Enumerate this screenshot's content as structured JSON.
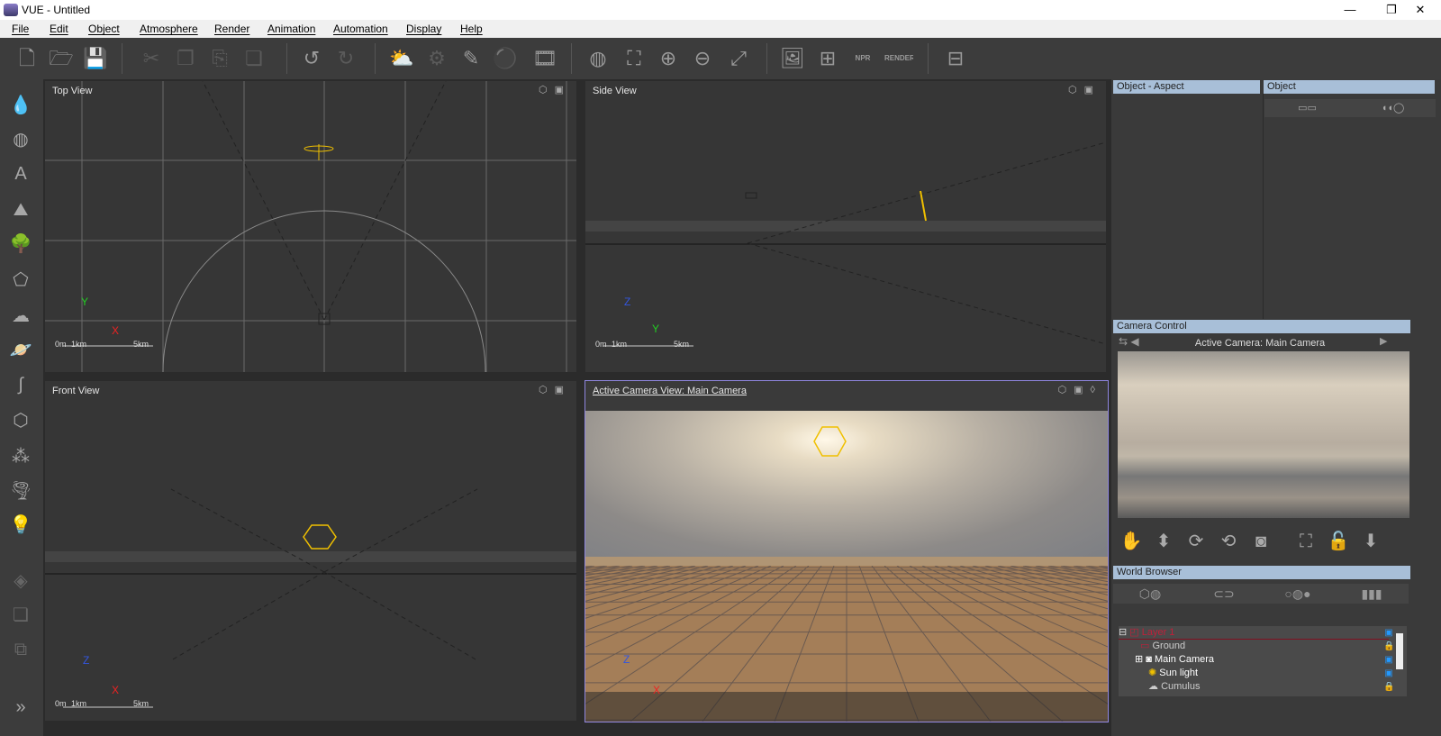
{
  "window": {
    "title": "VUE - Untitled",
    "controls": [
      "—",
      "❐",
      "✕"
    ]
  },
  "menu": [
    "File",
    "Edit",
    "Object",
    "Atmosphere",
    "Render",
    "Animation",
    "Automation",
    "Display",
    "Help"
  ],
  "toolbar": [
    {
      "icon": "new-file-icon",
      "glyph": "🗋"
    },
    {
      "icon": "open-folder-icon",
      "glyph": "🗁"
    },
    {
      "icon": "save-icon",
      "glyph": "💾"
    },
    {
      "icon": "cut-icon",
      "glyph": "✂"
    },
    {
      "icon": "copy-icon",
      "glyph": "❐"
    },
    {
      "icon": "paste-icon",
      "glyph": "⎘"
    },
    {
      "icon": "duplicate-icon",
      "glyph": "❏"
    },
    {
      "icon": "undo-icon",
      "glyph": "↺"
    },
    {
      "icon": "redo-icon",
      "glyph": "↻"
    },
    {
      "icon": "atmosphere-icon",
      "glyph": "⛅"
    },
    {
      "icon": "function-icon",
      "glyph": "⚙"
    },
    {
      "icon": "material-brush-icon",
      "glyph": "✎"
    },
    {
      "icon": "materials-icon",
      "glyph": "⚫"
    },
    {
      "icon": "film-icon",
      "glyph": "🎞"
    },
    {
      "icon": "globe-icon",
      "glyph": "◍"
    },
    {
      "icon": "frame-all-icon",
      "glyph": "⛶"
    },
    {
      "icon": "zoom-in-icon",
      "glyph": "⊕"
    },
    {
      "icon": "zoom-out-icon",
      "glyph": "⊖"
    },
    {
      "icon": "maximize-icon",
      "glyph": "⤢"
    },
    {
      "icon": "render-gallery-icon",
      "glyph": "🖼"
    },
    {
      "icon": "render-area-icon",
      "glyph": "⊞"
    },
    {
      "icon": "npr-render-icon",
      "glyph": "NPR"
    },
    {
      "icon": "render-icon",
      "glyph": "RENDER"
    },
    {
      "icon": "layout-icon",
      "glyph": "⊟"
    }
  ],
  "lefttools": [
    {
      "icon": "water-icon",
      "glyph": "💧"
    },
    {
      "icon": "sphere-icon",
      "glyph": "◍"
    },
    {
      "icon": "text-icon",
      "glyph": "A"
    },
    {
      "icon": "terrain-icon",
      "glyph": "⛰"
    },
    {
      "icon": "plant-icon",
      "glyph": "🌳"
    },
    {
      "icon": "rock-icon",
      "glyph": "⬠"
    },
    {
      "icon": "cloud-icon",
      "glyph": "☁"
    },
    {
      "icon": "planet-icon",
      "glyph": "🪐"
    },
    {
      "icon": "path-icon",
      "glyph": "∫"
    },
    {
      "icon": "cube-icon",
      "glyph": "⬡"
    },
    {
      "icon": "ecosystem-icon",
      "glyph": "⁂"
    },
    {
      "icon": "wind-icon",
      "glyph": "🌪"
    },
    {
      "icon": "light-icon",
      "glyph": "💡"
    },
    {
      "icon": "boolean-icon",
      "glyph": "◈"
    },
    {
      "icon": "group-icon",
      "glyph": "❏"
    },
    {
      "icon": "metablob-icon",
      "glyph": "⧉"
    },
    {
      "icon": "expand-icon",
      "glyph": "»"
    }
  ],
  "viewports": {
    "top": {
      "label": "Top View",
      "axes": [
        "Y",
        "X"
      ],
      "scale": [
        "0m",
        "1km",
        "5km"
      ]
    },
    "side": {
      "label": "Side View",
      "axes": [
        "Z",
        "Y"
      ],
      "scale": [
        "0m",
        "1km",
        "5km"
      ]
    },
    "front": {
      "label": "Front View",
      "axes": [
        "Z",
        "X"
      ],
      "scale": [
        "0m",
        "1km",
        "5km"
      ]
    },
    "camera": {
      "label": "Active Camera View: Main Camera",
      "axes": [
        "Z",
        "X"
      ]
    }
  },
  "panels": {
    "aspect": {
      "title": "Object - Aspect"
    },
    "object": {
      "title": "Object"
    },
    "camera_control": {
      "title": "Camera Control",
      "active": "Active Camera: Main Camera"
    },
    "world_browser": {
      "title": "World Browser",
      "items": [
        {
          "name": "Layer 1",
          "color": "#c0203a"
        },
        {
          "name": "Ground"
        },
        {
          "name": "Main Camera"
        },
        {
          "name": "Sun light"
        },
        {
          "name": "Cumulus"
        }
      ]
    }
  },
  "colors": {
    "accent": "#8f86e0",
    "panel_header": "#a8bfd8",
    "layer": "#c0203a",
    "gizmo": "#f0c000"
  }
}
